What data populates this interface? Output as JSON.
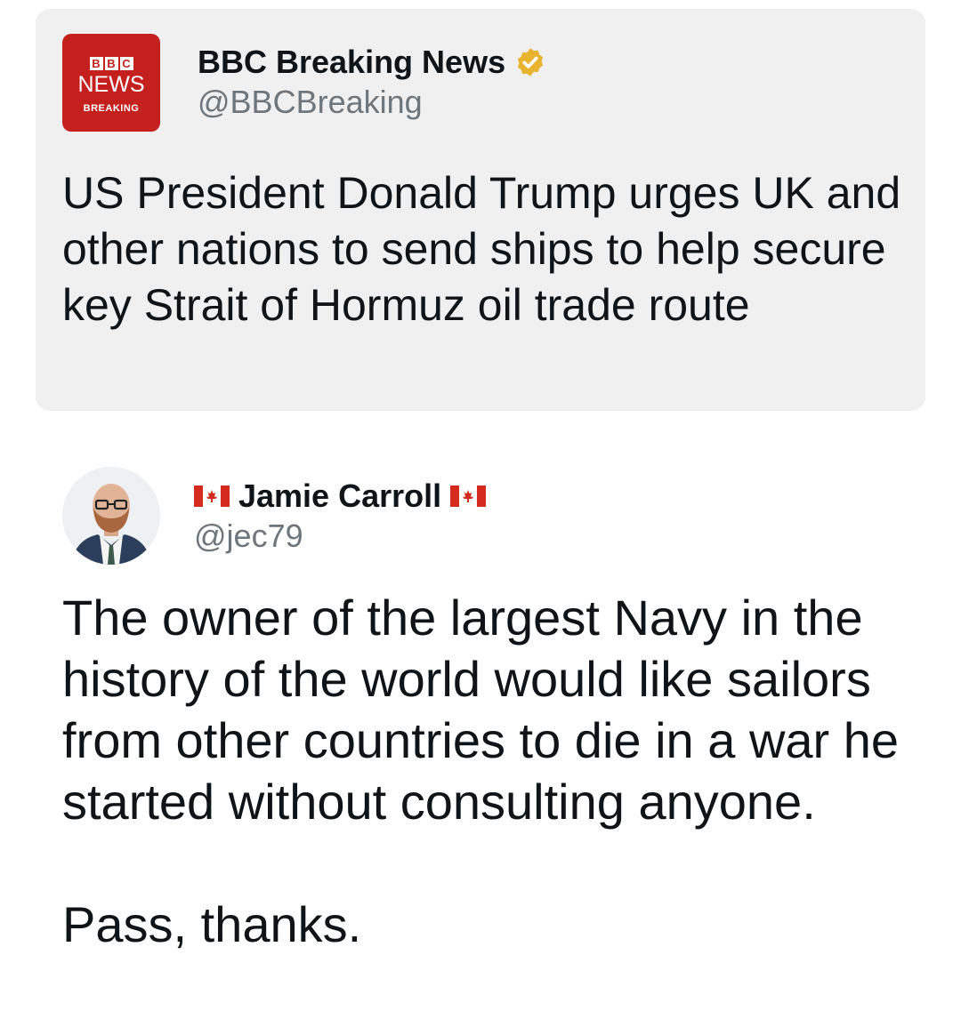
{
  "quoted_tweet": {
    "logo": {
      "blocks": [
        "B",
        "B",
        "C"
      ],
      "news_label": "NEWS",
      "breaking_label": "BREAKING",
      "brand_color": "#c4211e"
    },
    "display_name": "BBC Breaking News",
    "verified_icon": "verified-badge-gold",
    "handle": "@BBCBreaking",
    "text": "US President Donald Trump urges UK and other nations to send ships to help secure key Strait of Hormuz oil trade route"
  },
  "main_tweet": {
    "avatar_icon": "user-avatar-photo",
    "flag_icon": "canada-flag",
    "display_name": "Jamie Carroll",
    "handle": "@jec79",
    "text": "The owner of the largest Navy in the history of the world would like sailors from other countries to die in a war he started without consulting anyone.\n\nPass, thanks."
  }
}
